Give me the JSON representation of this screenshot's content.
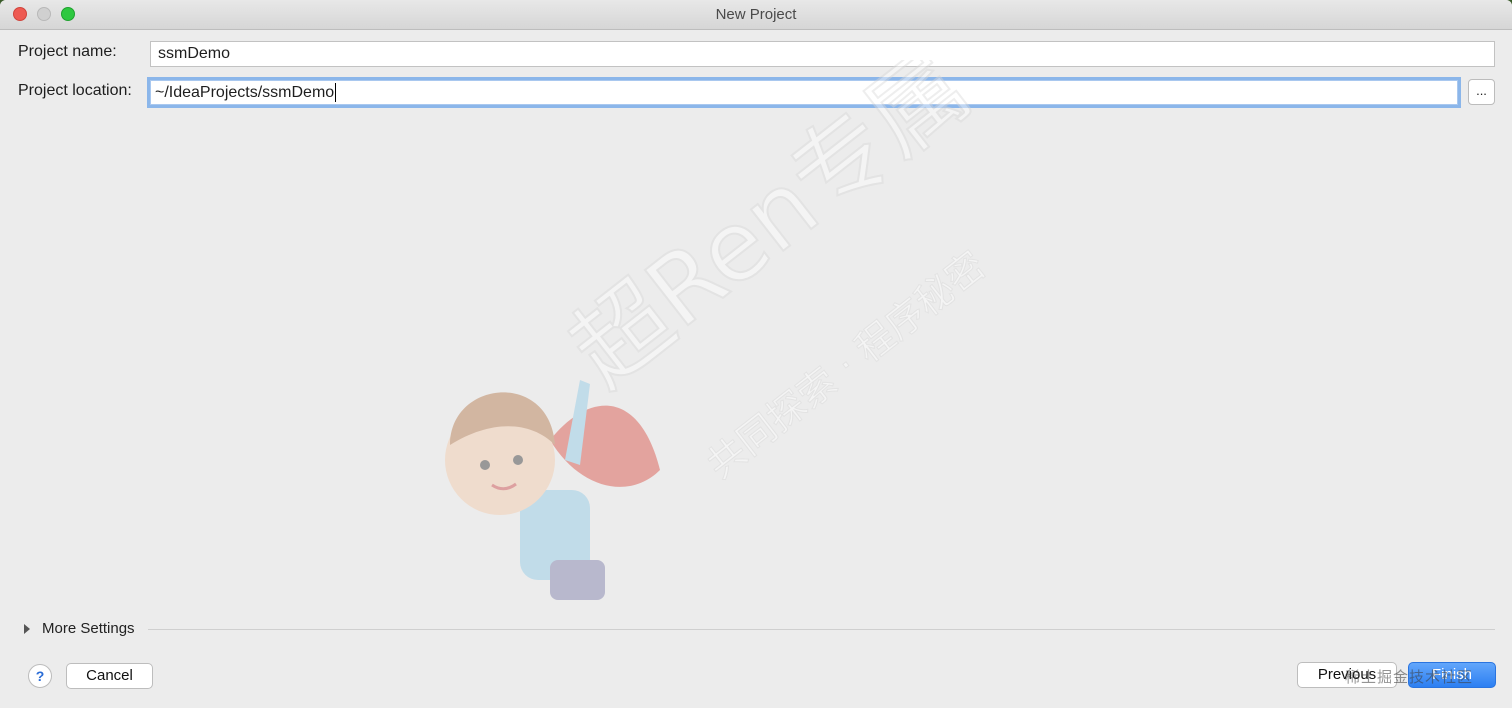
{
  "window": {
    "title": "New Project"
  },
  "form": {
    "project_name_label": "Project name:",
    "project_name_value": "ssmDemo",
    "project_location_label": "Project location:",
    "project_location_value": "~/IdeaProjects/ssmDemo",
    "browse_label": "..."
  },
  "more_settings": {
    "label": "More Settings"
  },
  "footer": {
    "help_label": "?",
    "cancel_label": "Cancel",
    "previous_label": "Previous",
    "finish_label": "Finish"
  },
  "watermark": {
    "brand": "超Ren专属",
    "tagline": "共同探索 · 程序秘密",
    "footer_text": "稀土掘金技术社区"
  },
  "colors": {
    "accent": "#2c7ff2",
    "focus_ring": "#8bb6ea",
    "close": "#ee5a52",
    "maximize": "#2ec840"
  }
}
